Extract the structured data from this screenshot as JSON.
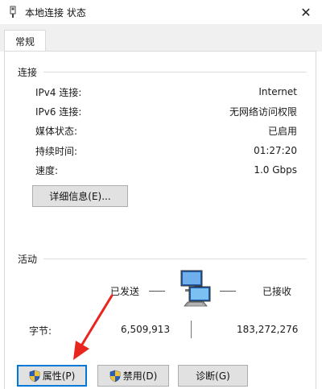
{
  "window": {
    "title": "本地连接 状态",
    "close_glyph": "✕"
  },
  "tabs": [
    {
      "label": "常规"
    }
  ],
  "connection": {
    "header": "连接",
    "rows": [
      {
        "label": "IPv4 连接:",
        "value": "Internet"
      },
      {
        "label": "IPv6 连接:",
        "value": "无网络访问权限"
      },
      {
        "label": "媒体状态:",
        "value": "已启用"
      },
      {
        "label": "持续时间:",
        "value": "01:27:20"
      },
      {
        "label": "速度:",
        "value": "1.0 Gbps"
      }
    ],
    "details_button": "详细信息(E)..."
  },
  "activity": {
    "header": "活动",
    "sent_label": "已发送",
    "received_label": "已接收",
    "bytes_label": "字节:",
    "bytes_sent": "6,509,913",
    "bytes_received": "183,272,276",
    "icon": "network-computers-icon"
  },
  "buttons": {
    "properties": "属性(P)",
    "disable": "禁用(D)",
    "diagnose": "诊断(G)"
  },
  "annotation": {
    "arrow_color": "#e8251f"
  },
  "colors": {
    "accent": "#0078d7",
    "button_face": "#e1e1e1",
    "tab_strip": "#f0f0f0"
  }
}
